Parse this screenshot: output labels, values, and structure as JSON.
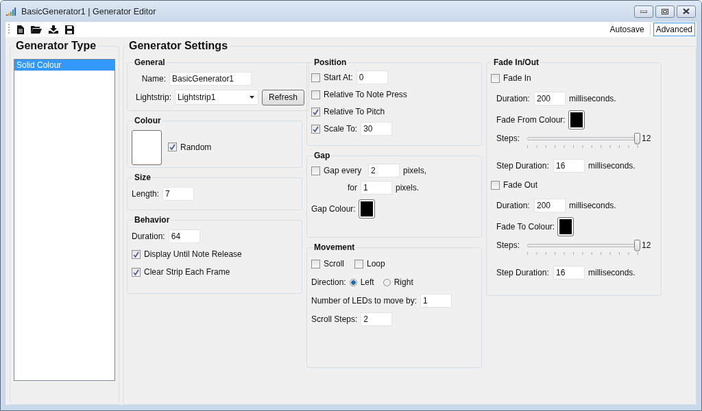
{
  "window": {
    "title": "BasicGenerator1 | Generator Editor"
  },
  "toolbar": {
    "buttons": [
      {
        "label": "Autosave",
        "selected": false
      },
      {
        "label": "Advanced",
        "selected": true
      }
    ]
  },
  "generator_type": {
    "title": "Generator Type",
    "items": [
      {
        "label": "Solid Colour",
        "selected": true
      }
    ]
  },
  "settings": {
    "title": "Generator Settings",
    "general": {
      "title": "General",
      "name_label": "Name:",
      "name_value": "BasicGenerator1",
      "lightstrip_label": "Lightstrip:",
      "lightstrip_value": "Lightstrip1",
      "refresh": "Refresh"
    },
    "colour": {
      "title": "Colour",
      "random": {
        "label": "Random",
        "checked": true
      }
    },
    "size": {
      "title": "Size",
      "length_label": "Length:",
      "length_value": "7"
    },
    "behavior": {
      "title": "Behavior",
      "duration_label": "Duration:",
      "duration_value": "64",
      "options": [
        {
          "label": "Display Until Note Release",
          "checked": true
        },
        {
          "label": "Clear Strip Each Frame",
          "checked": true
        }
      ]
    },
    "position": {
      "title": "Position",
      "rows": [
        {
          "label": "Start At:",
          "checked": false,
          "value": "0"
        },
        {
          "label": "Relative To Note Press",
          "checked": false
        },
        {
          "label": "Relative To Pitch",
          "checked": true
        },
        {
          "label": "Scale To:",
          "checked": true,
          "value": "30"
        }
      ]
    },
    "gap": {
      "title": "Gap",
      "enabled": {
        "label": "Gap every",
        "checked": false
      },
      "every_value": "2",
      "every_unit": "pixels,",
      "for_label": "for",
      "for_value": "1",
      "for_unit": "pixels.",
      "colour_label": "Gap Colour:"
    },
    "movement": {
      "title": "Movement",
      "toggles": [
        {
          "label": "Scroll",
          "checked": false
        },
        {
          "label": "Loop",
          "checked": false
        }
      ],
      "direction_label": "Direction:",
      "directions": [
        {
          "label": "Left",
          "selected": true
        },
        {
          "label": "Right",
          "selected": false
        }
      ],
      "leds_label": "Number of LEDs to move by:",
      "leds_value": "1",
      "steps_label": "Scroll Steps:",
      "steps_value": "2"
    },
    "fade": {
      "title": "Fade In/Out",
      "sections": [
        {
          "label": "Fade In",
          "checked": false,
          "duration_label": "Duration:",
          "duration_value": "200",
          "duration_unit": "milliseconds.",
          "colour_label": "Fade From Colour:",
          "steps_label": "Steps:",
          "level": 1,
          "steps_value": "12",
          "step_duration_label": "Step Duration:",
          "step_duration_value": "16",
          "step_duration_unit": "milliseconds."
        },
        {
          "label": "Fade Out",
          "checked": false,
          "duration_label": "Duration:",
          "duration_value": "200",
          "duration_unit": "milliseconds.",
          "colour_label": "Fade To Colour:",
          "steps_label": "Steps:",
          "level": 1,
          "steps_value": "12",
          "step_duration_label": "Step Duration:",
          "step_duration_value": "16",
          "step_duration_unit": "milliseconds."
        }
      ]
    }
  }
}
